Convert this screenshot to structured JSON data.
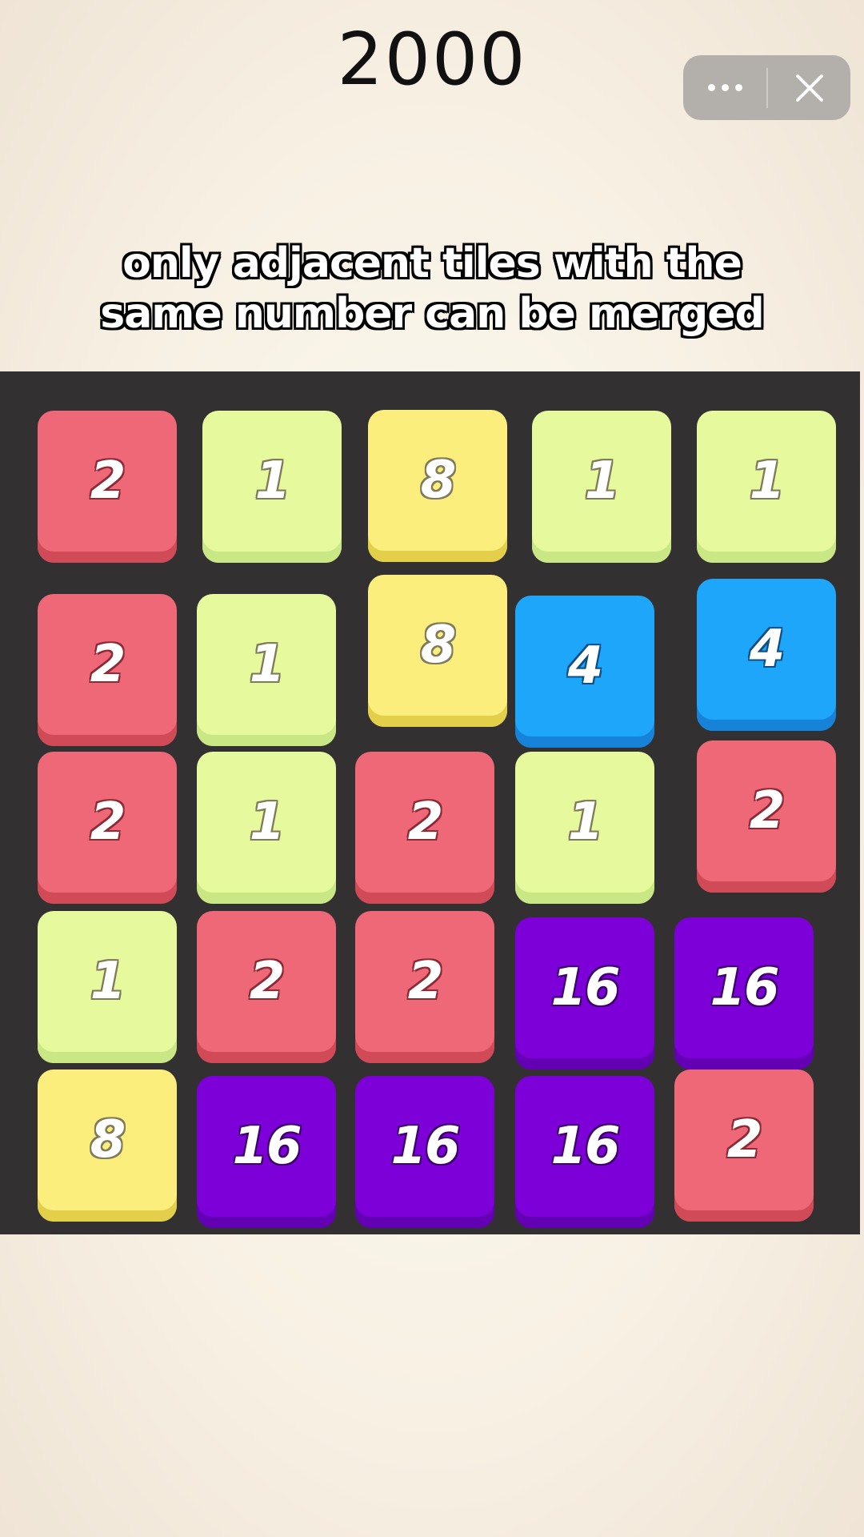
{
  "score": "2000",
  "capsule": {
    "more_icon": "ellipsis-icon",
    "close_icon": "close-icon"
  },
  "caption": {
    "line1": "only adjacent tiles with the",
    "line2": "same number can be merged"
  },
  "board": {
    "tiles": [
      {
        "value": "2",
        "kind": "t2"
      },
      {
        "value": "1",
        "kind": "t1"
      },
      {
        "value": "8",
        "kind": "t8"
      },
      {
        "value": "1",
        "kind": "t1"
      },
      {
        "value": "1",
        "kind": "t1"
      },
      {
        "value": "2",
        "kind": "t2"
      },
      {
        "value": "1",
        "kind": "t1"
      },
      {
        "value": "8",
        "kind": "t8"
      },
      {
        "value": "4",
        "kind": "t4"
      },
      {
        "value": "4",
        "kind": "t4"
      },
      {
        "value": "2",
        "kind": "t2"
      },
      {
        "value": "1",
        "kind": "t1"
      },
      {
        "value": "2",
        "kind": "t2"
      },
      {
        "value": "1",
        "kind": "t1"
      },
      {
        "value": "2",
        "kind": "t2"
      },
      {
        "value": "1",
        "kind": "t1"
      },
      {
        "value": "2",
        "kind": "t2"
      },
      {
        "value": "2",
        "kind": "t2"
      },
      {
        "value": "16",
        "kind": "t16"
      },
      {
        "value": "16",
        "kind": "t16"
      },
      {
        "value": "8",
        "kind": "t8"
      },
      {
        "value": "16",
        "kind": "t16"
      },
      {
        "value": "16",
        "kind": "t16"
      },
      {
        "value": "16",
        "kind": "t16"
      },
      {
        "value": "2",
        "kind": "t2"
      }
    ]
  },
  "colors": {
    "tile_1": "#e6f99d",
    "tile_2": "#ee6878",
    "tile_4": "#1ea7fa",
    "tile_8": "#fbee7c",
    "tile_16": "#7d00d8",
    "board": "#323030"
  }
}
